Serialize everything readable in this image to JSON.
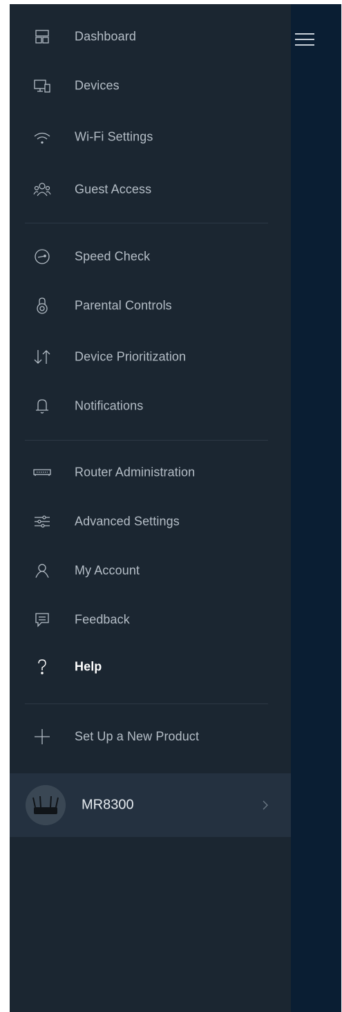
{
  "nav": {
    "items": [
      {
        "label": "Dashboard",
        "icon": "dashboard-icon"
      },
      {
        "label": "Devices",
        "icon": "devices-icon"
      },
      {
        "label": "Wi-Fi Settings",
        "icon": "wifi-icon"
      },
      {
        "label": "Guest Access",
        "icon": "guest-access-icon"
      },
      {
        "label": "Speed Check",
        "icon": "speedometer-icon"
      },
      {
        "label": "Parental Controls",
        "icon": "lock-icon"
      },
      {
        "label": "Device Prioritization",
        "icon": "priority-arrows-icon"
      },
      {
        "label": "Notifications",
        "icon": "bell-icon"
      },
      {
        "label": "Router Administration",
        "icon": "router-icon"
      },
      {
        "label": "Advanced Settings",
        "icon": "sliders-icon"
      },
      {
        "label": "My Account",
        "icon": "user-icon"
      },
      {
        "label": "Feedback",
        "icon": "feedback-icon"
      },
      {
        "label": "Help",
        "icon": "help-icon",
        "active": true
      },
      {
        "label": "Set Up a New Product",
        "icon": "plus-icon"
      }
    ]
  },
  "router": {
    "name": "MR8300"
  },
  "colors": {
    "drawer_bg": "#1b2631",
    "screen_bg": "#0a1e33",
    "text": "#b4bdc6",
    "active_text": "#ffffff"
  }
}
